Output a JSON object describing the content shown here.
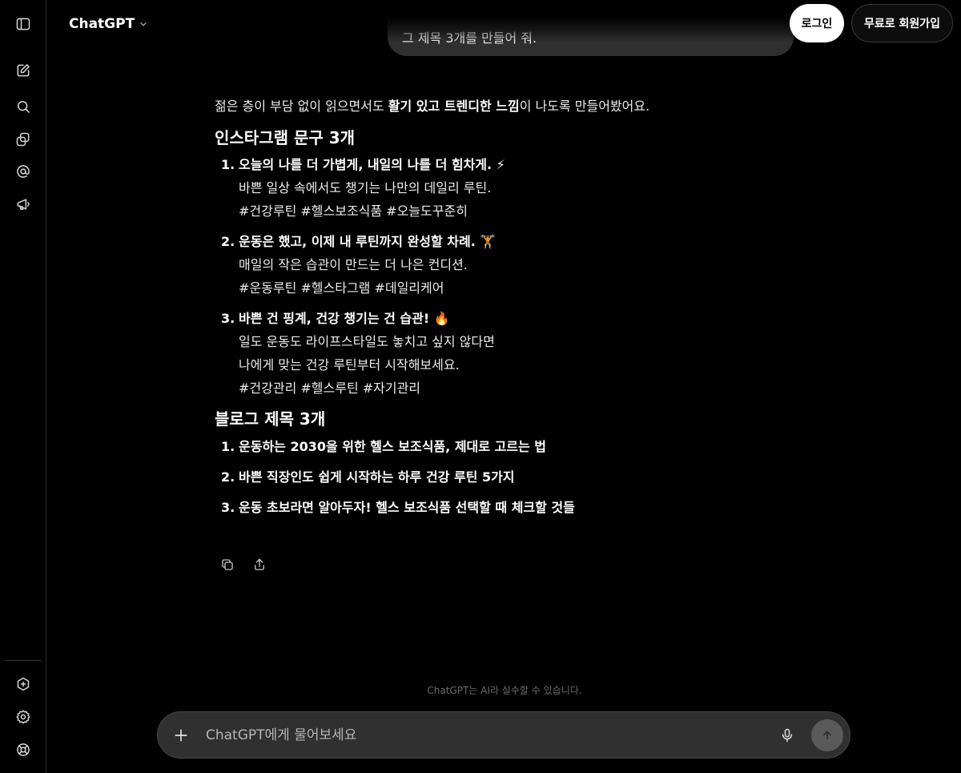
{
  "header": {
    "model_label": "ChatGPT",
    "login_label": "로그인",
    "signup_label": "무료로 회원가입"
  },
  "user_message": "그 제목 3개를 만들어 줘.",
  "answer": {
    "intro_prefix": "젊은 층이 부담 없이 읽으면서도 ",
    "intro_bold": "활기 있고 트렌디한 느낌",
    "intro_suffix": "이 나도록 만들어봤어요.",
    "instagram_heading": "인스타그램 문구 3개",
    "instagram": [
      {
        "num": "1.",
        "title": "오늘의 나를 더 가볍게, 내일의 나를 더 힘차게. ⚡",
        "lines": [
          "바쁜 일상 속에서도 챙기는 나만의 데일리 루틴.",
          "#건강루틴 #헬스보조식품 #오늘도꾸준히"
        ]
      },
      {
        "num": "2.",
        "title": "운동은 했고, 이제 내 루틴까지 완성할 차례. 🏋",
        "lines": [
          "매일의 작은 습관이 만드는 더 나은 컨디션.",
          "#운동루틴 #헬스타그램 #데일리케어"
        ]
      },
      {
        "num": "3.",
        "title": "바쁜 건 핑계, 건강 챙기는 건 습관! 🔥",
        "lines": [
          "일도 운동도 라이프스타일도 놓치고 싶지 않다면",
          "나에게 맞는 건강 루틴부터 시작해보세요.",
          "#건강관리 #헬스루틴 #자기관리"
        ]
      }
    ],
    "blog_heading": "블로그 제목 3개",
    "blog": [
      {
        "num": "1.",
        "title": "운동하는 2030을 위한 헬스 보조식품, 제대로 고르는 법"
      },
      {
        "num": "2.",
        "title": "바쁜 직장인도 쉽게 시작하는 하루 건강 루틴 5가지"
      },
      {
        "num": "3.",
        "title": "운동 초보라면 알아두자! 헬스 보조식품 선택할 때 체크할 것들"
      }
    ]
  },
  "disclaimer": "ChatGPT는 AI라 실수할 수 있습니다.",
  "composer": {
    "placeholder": "ChatGPT에게 물어보세요"
  },
  "sidebar_icons": [
    "sidebar-toggle-icon",
    "new-chat-icon",
    "search-icon",
    "library-icon",
    "at-sign-icon",
    "megaphone-icon",
    "gpts-icon",
    "settings-icon",
    "help-icon"
  ]
}
